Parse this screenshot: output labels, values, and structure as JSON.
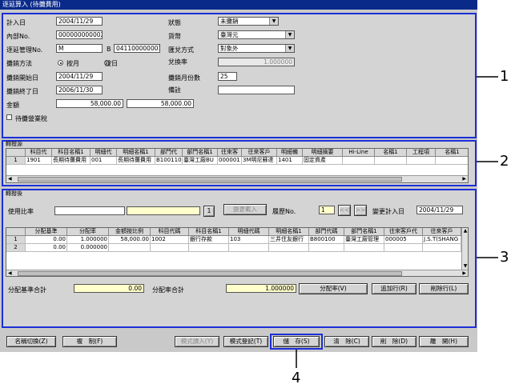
{
  "window": {
    "title": "逐延算入 (待攤費用)"
  },
  "header": {
    "fields": {
      "date_label": "計入日",
      "date_value": "2004/11/29",
      "internal_no_label": "內部No.",
      "internal_no_value": "0000000000025",
      "mgmt_no_label": "逐延管理No.",
      "mgmt_no_a": "M",
      "mgmt_no_b_label": "B",
      "mgmt_no_b": "041100000001",
      "method_label": "攤銷方法",
      "method_opt1": "按月",
      "method_opt2": "按日",
      "start_label": "攤銷開始日",
      "start_value": "2004/11/29",
      "end_label": "攤銷終了日",
      "end_value": "2006/11/30",
      "amount_label": "金額",
      "amount_value1": "58,000.00",
      "amount_value2": "58,000.00",
      "checkbox_label": "待攤營業稅",
      "status_label": "狀態",
      "status_value": "未攤銷",
      "currency_label": "貨幣",
      "currency_value": "臺灣元",
      "fx_method_label": "匯兌方式",
      "fx_method_value": "對象外",
      "rate_label": "兌換率",
      "rate_value": "1.000000",
      "months_label": "攤銷月份數",
      "months_value": "25",
      "remark_label": "備註",
      "remark_value": ""
    }
  },
  "transfer_from": {
    "label": "轉撥源",
    "columns": [
      "",
      "科目代",
      "科目名稱1",
      "明細代",
      "明細名稱1",
      "部門代",
      "部門名稱1",
      "往來客",
      "往來客戶",
      "明細備",
      "明細摘要",
      "Hi-Line",
      "名稱1",
      "工程項",
      "名稱1"
    ],
    "rows": [
      [
        "1",
        "1901",
        "長期待攤費用",
        "001",
        "長期待攤費用",
        "B100110",
        "臺灣工廠BU",
        "000001",
        "3M明尼蘇達",
        "1401",
        "固定資產",
        "",
        "",
        "",
        ""
      ]
    ]
  },
  "transfer_to": {
    "label": "轉撥後",
    "ratio_label": "使用比率",
    "ratio_value": "",
    "ratio_value2": "",
    "ratio_btn": "1",
    "change_btn": "變更載入",
    "history_label": "履歷No.",
    "history_value": "1",
    "prev_btn": "<<",
    "next_btn": ">>",
    "change_date_label": "變更計入日",
    "change_date_value": "2004/11/29",
    "columns": [
      "",
      "分配基準",
      "分配率",
      "金額按比例",
      "科目代碼",
      "科目名稱1",
      "明細代碼",
      "明細名稱1",
      "部門代碼",
      "部門名稱1",
      "往來客戶代",
      "往來客戶"
    ],
    "rows": [
      [
        "1",
        "0.00",
        "1.000000",
        "58,000.00",
        "1002",
        "銀行存款",
        "103",
        "三井住友銀行",
        "B800100",
        "臺灣工廠管理",
        "000005",
        "J.S.T(SHANG"
      ],
      [
        "2",
        "0.00",
        "0.000000",
        "",
        "",
        "",
        "",
        "",
        "",
        "",
        "",
        ""
      ]
    ],
    "base_total_label": "分配基準合計",
    "base_total_value": "0.00",
    "rate_total_label": "分配率合計",
    "rate_total_value": "1.000000",
    "rate_btn": "分配率(V)",
    "add_row_btn": "追加行(R)",
    "del_row_btn": "削除行(L)"
  },
  "footer": {
    "buttons": [
      "名稱切換(Z)",
      "複　制(F)",
      "模式讀入(Y)",
      "模式登記(T)",
      "儲　存(S)",
      "清　除(C)",
      "削　除(D)",
      "離　開(H)"
    ]
  },
  "callouts": [
    "1",
    "2",
    "3",
    "4"
  ]
}
